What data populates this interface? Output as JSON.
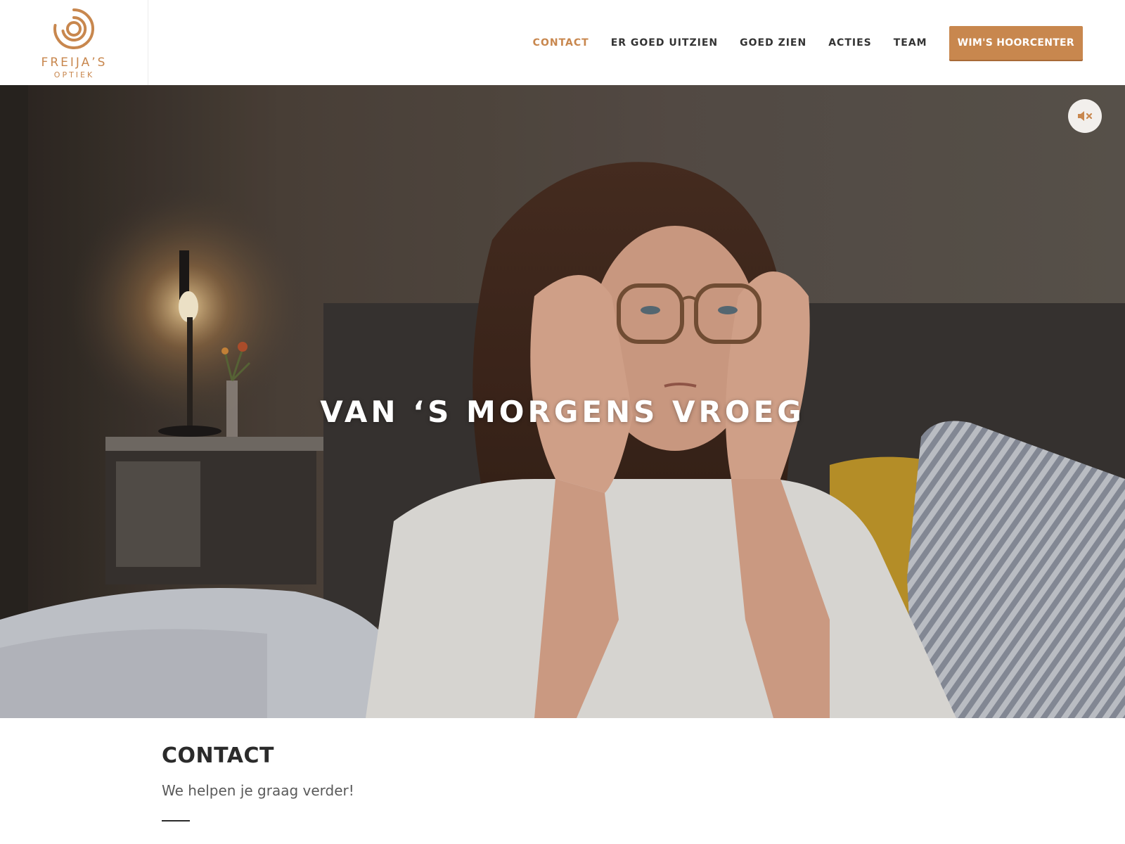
{
  "brand": {
    "name": "FREIJA’S",
    "subtitle": "OPTIEK",
    "logo_icon": "concentric-circles-logo",
    "accent_color": "#c8874e"
  },
  "nav": {
    "items": [
      {
        "label": "CONTACT",
        "active": true
      },
      {
        "label": "ER GOED UITZIEN",
        "active": false
      },
      {
        "label": "GOED ZIEN",
        "active": false
      },
      {
        "label": "ACTIES",
        "active": false
      },
      {
        "label": "TEAM",
        "active": false
      }
    ],
    "cta_label": "WIM'S HOORCENTER"
  },
  "hero": {
    "headline": "VAN ‘S MORGENS VROEG",
    "mute_icon": "speaker-muted-icon"
  },
  "contact": {
    "title": "CONTACT",
    "subtitle": "We helpen je graag verder!"
  }
}
